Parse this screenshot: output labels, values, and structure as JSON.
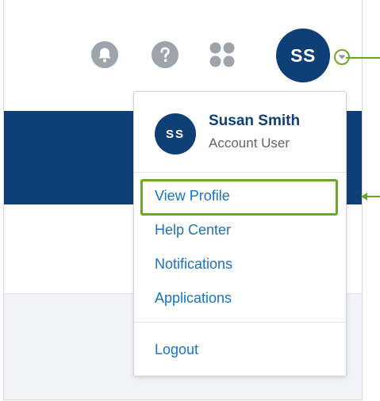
{
  "header": {
    "avatar_initials": "SS",
    "icons": [
      "bell-icon",
      "question-icon",
      "apps-grid-icon",
      "chevron-down-icon"
    ]
  },
  "user_menu": {
    "avatar_initials": "SS",
    "name": "Susan Smith",
    "role": "Account User",
    "items": [
      {
        "label": "View Profile"
      },
      {
        "label": "Help Center"
      },
      {
        "label": "Notifications"
      },
      {
        "label": "Applications"
      }
    ],
    "logout_label": "Logout"
  },
  "colors": {
    "brand_blue": "#0e4077",
    "link_blue": "#1a73c1",
    "highlight_green": "#6aa82a",
    "icon_gray": "#9ea4ab"
  }
}
